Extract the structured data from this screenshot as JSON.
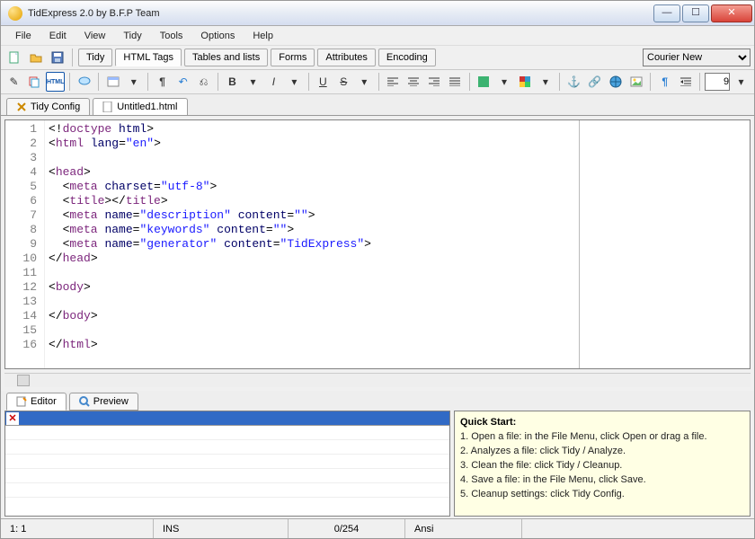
{
  "window": {
    "title": "TidExpress 2.0 by B.F.P Team"
  },
  "menu": [
    "File",
    "Edit",
    "View",
    "Tidy",
    "Tools",
    "Options",
    "Help"
  ],
  "toolbar1_tabs": [
    "Tidy",
    "HTML Tags",
    "Tables and lists",
    "Forms",
    "Attributes",
    "Encoding"
  ],
  "active_tab1": 1,
  "font": {
    "name": "Courier New"
  },
  "format_number": "9",
  "doc_tabs": [
    {
      "label": "Tidy Config",
      "active": false
    },
    {
      "label": "Untitled1.html",
      "active": true
    }
  ],
  "code_lines": [
    {
      "n": 1,
      "html": "&lt;!<span class='tag'>doctype</span> <span class='attr'>html</span>&gt;"
    },
    {
      "n": 2,
      "html": "&lt;<span class='tag'>html</span> <span class='attr'>lang</span>=<span class='val'>\"en\"</span>&gt;"
    },
    {
      "n": 3,
      "html": ""
    },
    {
      "n": 4,
      "html": "&lt;<span class='tag'>head</span>&gt;"
    },
    {
      "n": 5,
      "html": "  &lt;<span class='tag'>meta</span> <span class='attr'>charset</span>=<span class='val'>\"utf-8\"</span>&gt;"
    },
    {
      "n": 6,
      "html": "  &lt;<span class='tag'>title</span>&gt;&lt;/<span class='tag'>title</span>&gt;"
    },
    {
      "n": 7,
      "html": "  &lt;<span class='tag'>meta</span> <span class='attr'>name</span>=<span class='val'>\"description\"</span> <span class='attr'>content</span>=<span class='val'>\"\"</span>&gt;"
    },
    {
      "n": 8,
      "html": "  &lt;<span class='tag'>meta</span> <span class='attr'>name</span>=<span class='val'>\"keywords\"</span> <span class='attr'>content</span>=<span class='val'>\"\"</span>&gt;"
    },
    {
      "n": 9,
      "html": "  &lt;<span class='tag'>meta</span> <span class='attr'>name</span>=<span class='val'>\"generator\"</span> <span class='attr'>content</span>=<span class='val'>\"TidExpress\"</span>&gt;"
    },
    {
      "n": 10,
      "html": "&lt;/<span class='tag'>head</span>&gt;"
    },
    {
      "n": 11,
      "html": ""
    },
    {
      "n": 12,
      "html": "&lt;<span class='tag'>body</span>&gt;"
    },
    {
      "n": 13,
      "html": ""
    },
    {
      "n": 14,
      "html": "&lt;/<span class='tag'>body</span>&gt;"
    },
    {
      "n": 15,
      "html": ""
    },
    {
      "n": 16,
      "html": "&lt;/<span class='tag'>html</span>&gt;"
    }
  ],
  "view_tabs": [
    {
      "label": "Editor",
      "active": true
    },
    {
      "label": "Preview",
      "active": false
    }
  ],
  "quickstart": {
    "title": "Quick Start:",
    "items": [
      "1. Open a file: in the File Menu, click Open or drag a file.",
      "2. Analyzes a file: click Tidy / Analyze.",
      "3. Clean the file: click Tidy / Cleanup.",
      "4. Save a file: in the File Menu, click Save.",
      "5. Cleanup settings: click Tidy Config."
    ]
  },
  "status": {
    "pos": "1:  1",
    "mode": "INS",
    "chars": "0/254",
    "enc": "Ansi"
  }
}
